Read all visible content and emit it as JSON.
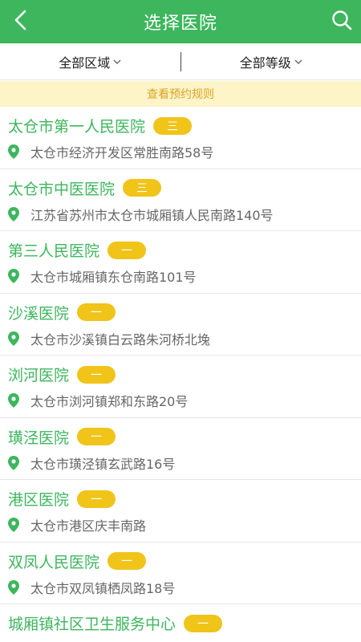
{
  "header": {
    "title": "选择医院",
    "back_icon": "chevron-left-icon",
    "search_icon": "search-icon"
  },
  "filters": {
    "region": "全部区域",
    "level": "全部等级"
  },
  "rules_link": "查看预约规则",
  "colors": {
    "primary": "#3db65d",
    "badge": "#f0c419",
    "notice_bg": "#fdf4c8",
    "notice_text": "#d9a524"
  },
  "hospitals": [
    {
      "name": "太仓市第一人民医院",
      "level": "三",
      "address": "太仓市经济开发区常胜南路58号"
    },
    {
      "name": "太仓市中医医院",
      "level": "三",
      "address": "江苏省苏州市太仓市城厢镇人民南路140号"
    },
    {
      "name": "第三人民医院",
      "level": "一",
      "address": "太仓市城厢镇东仓南路101号"
    },
    {
      "name": "沙溪医院",
      "level": "一",
      "address": "太仓市沙溪镇白云路朱河桥北堍"
    },
    {
      "name": "浏河医院",
      "level": "一",
      "address": "太仓市浏河镇郑和东路20号"
    },
    {
      "name": "璜泾医院",
      "level": "一",
      "address": "太仓市璜泾镇玄武路16号"
    },
    {
      "name": "港区医院",
      "level": "一",
      "address": "太仓市港区庆丰南路"
    },
    {
      "name": "双凤人民医院",
      "level": "一",
      "address": "太仓市双凤镇栖凤路18号"
    },
    {
      "name": "城厢镇社区卫生服务中心",
      "level": "一",
      "address": ""
    }
  ]
}
